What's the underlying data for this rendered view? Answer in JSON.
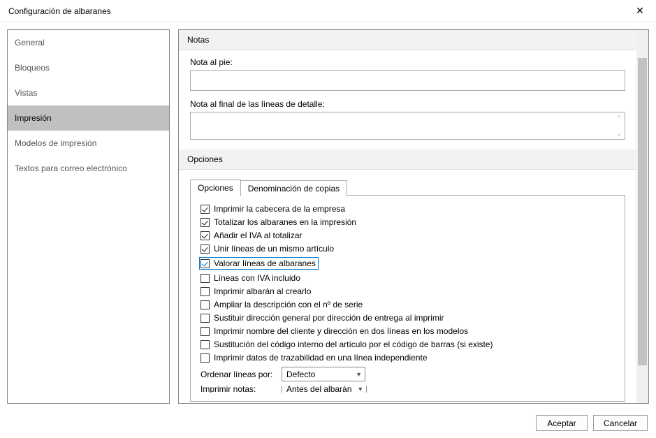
{
  "window": {
    "title": "Configuración de albaranes"
  },
  "sidebar": {
    "items": [
      {
        "label": "General"
      },
      {
        "label": "Bloqueos"
      },
      {
        "label": "Vistas"
      },
      {
        "label": "Impresión",
        "selected": true
      },
      {
        "label": "Modelos de impresión"
      },
      {
        "label": "Textos para correo electrónico"
      }
    ]
  },
  "section_notas": {
    "header": "Notas",
    "nota_pie_label": "Nota al pie:",
    "nota_pie_value": "",
    "nota_final_label": "Nota al final de las líneas de detalle:",
    "nota_final_value": ""
  },
  "section_opciones": {
    "header": "Opciones",
    "tabs": [
      {
        "label": "Opciones",
        "active": true
      },
      {
        "label": "Denominación de copias",
        "active": false
      }
    ],
    "checkboxes": [
      {
        "label": "Imprimir la cabecera de la empresa",
        "checked": true
      },
      {
        "label": "Totalizar los albaranes en la impresión",
        "checked": true
      },
      {
        "label": "Añadir el IVA al totalizar",
        "checked": true
      },
      {
        "label": "Unir líneas de un mismo artículo",
        "checked": true
      },
      {
        "label": "Valorar líneas de albaranes",
        "checked": true,
        "highlighted": true
      },
      {
        "label": "Líneas con IVA incluido",
        "checked": false
      },
      {
        "label": "Imprimir albarán al crearlo",
        "checked": false
      },
      {
        "label": "Ampliar la descripción con el nº de serie",
        "checked": false
      },
      {
        "label": "Sustituir dirección general por dirección de entrega al imprimir",
        "checked": false
      },
      {
        "label": "Imprimir nombre del cliente y dirección en dos líneas en los modelos",
        "checked": false
      },
      {
        "label": "Sustitución del código interno del artículo por el código de barras (si existe)",
        "checked": false
      },
      {
        "label": "Imprimir datos de trazabilidad en una línea independiente",
        "checked": false
      }
    ],
    "ordenar_label": "Ordenar líneas por:",
    "ordenar_value": "Defecto",
    "imprimir_notas_label": "Imprimir notas:",
    "imprimir_notas_value": "Antes del albarán"
  },
  "footer": {
    "accept": "Aceptar",
    "cancel": "Cancelar"
  }
}
